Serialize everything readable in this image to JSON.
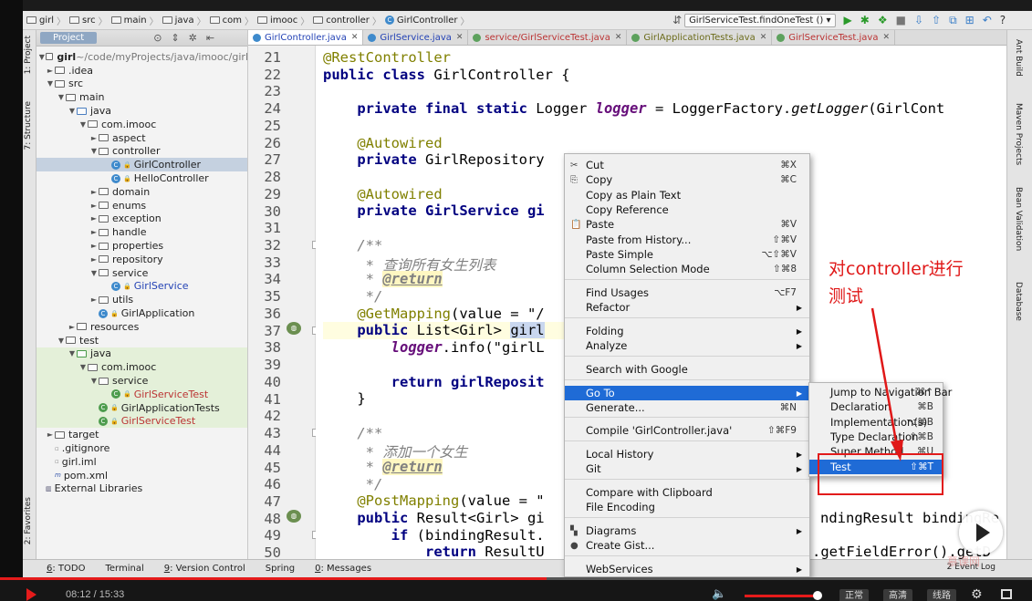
{
  "navbar": {
    "crumbs": [
      "girl",
      "src",
      "main",
      "java",
      "com",
      "imooc",
      "controller",
      "GirlController"
    ],
    "run_config": "GirlServiceTest.findOneTest ()"
  },
  "left_tabs": [
    "1: Project",
    "7: Structure",
    "2: Favorites"
  ],
  "project": {
    "title": "Project",
    "tree": [
      {
        "label": "girl",
        "suffix": " ~/code/myProjects/java/imooc/girl",
        "arrow": "▼",
        "icon": "folder",
        "bold": true
      },
      {
        "label": ".idea",
        "arrow": "►",
        "icon": "folder"
      },
      {
        "label": "src",
        "arrow": "▼",
        "icon": "folder"
      },
      {
        "label": "main",
        "arrow": "▼",
        "icon": "folder"
      },
      {
        "label": "java",
        "arrow": "▼",
        "icon": "srcfolder"
      },
      {
        "label": "com.imooc",
        "arrow": "▼",
        "icon": "pkg"
      },
      {
        "label": "aspect",
        "arrow": "►",
        "icon": "pkg"
      },
      {
        "label": "controller",
        "arrow": "▼",
        "icon": "pkg"
      },
      {
        "label": "GirlController",
        "arrow": "",
        "icon": "class",
        "selected": true
      },
      {
        "label": "HelloController",
        "arrow": "",
        "icon": "class"
      },
      {
        "label": "domain",
        "arrow": "►",
        "icon": "pkg"
      },
      {
        "label": "enums",
        "arrow": "►",
        "icon": "pkg"
      },
      {
        "label": "exception",
        "arrow": "►",
        "icon": "pkg"
      },
      {
        "label": "handle",
        "arrow": "►",
        "icon": "pkg"
      },
      {
        "label": "properties",
        "arrow": "►",
        "icon": "pkg"
      },
      {
        "label": "repository",
        "arrow": "►",
        "icon": "pkg"
      },
      {
        "label": "service",
        "arrow": "▼",
        "icon": "pkg"
      },
      {
        "label": "GirlService",
        "arrow": "",
        "icon": "class",
        "color": "blue"
      },
      {
        "label": "utils",
        "arrow": "►",
        "icon": "pkg"
      },
      {
        "label": "GirlApplication",
        "arrow": "",
        "icon": "class"
      },
      {
        "label": "resources",
        "arrow": "►",
        "icon": "folder"
      },
      {
        "label": "test",
        "arrow": "▼",
        "icon": "folder"
      },
      {
        "label": "java",
        "arrow": "▼",
        "icon": "testfolder",
        "green": true
      },
      {
        "label": "com.imooc",
        "arrow": "▼",
        "icon": "pkg",
        "green": true
      },
      {
        "label": "service",
        "arrow": "▼",
        "icon": "pkg",
        "green": true
      },
      {
        "label": "GirlServiceTest",
        "arrow": "",
        "icon": "testclass",
        "color": "red",
        "green": true
      },
      {
        "label": "GirlApplicationTests",
        "arrow": "",
        "icon": "testclass",
        "green": true
      },
      {
        "label": "GirlServiceTest",
        "arrow": "",
        "icon": "testclass",
        "color": "red",
        "green": true
      },
      {
        "label": "target",
        "arrow": "►",
        "icon": "folder"
      },
      {
        "label": ".gitignore",
        "arrow": "",
        "icon": "file"
      },
      {
        "label": "girl.iml",
        "arrow": "",
        "icon": "file"
      },
      {
        "label": "pom.xml",
        "arrow": "",
        "icon": "maven"
      },
      {
        "label": "External Libraries",
        "arrow": "",
        "icon": "lib"
      }
    ]
  },
  "tabs": [
    {
      "label": "GirlController.java",
      "active": true,
      "color": "blue"
    },
    {
      "label": "GirlService.java",
      "color": "blue"
    },
    {
      "label": "service/GirlServiceTest.java",
      "color": "red"
    },
    {
      "label": "GirlApplicationTests.java",
      "color": "olive"
    },
    {
      "label": "GirlServiceTest.java",
      "color": "red"
    }
  ],
  "line_numbers": [
    "21",
    "22",
    "23",
    "24",
    "25",
    "26",
    "27",
    "28",
    "29",
    "30",
    "31",
    "32",
    "33",
    "34",
    "35",
    "36",
    "37",
    "38",
    "39",
    "40",
    "41",
    "42",
    "43",
    "44",
    "45",
    "46",
    "47",
    "48",
    "49",
    "50"
  ],
  "code": {
    "l21": "@RestController",
    "l22a": "public class",
    "l22b": " GirlController {",
    "l24a": "    private final static",
    "l24b": " Logger ",
    "l24c": "logger",
    "l24d": " = LoggerFactory.",
    "l24e": "getLogger",
    "l24f": "(GirlCont",
    "l26": "    @Autowired",
    "l27a": "    private",
    "l27b": " GirlRepository",
    "l29": "    @Autowired",
    "l30a": "    private",
    "l30b": " GirlService gi",
    "l32": "    /**",
    "l33": "     * 查询所有女生列表",
    "l34a": "     * ",
    "l34b": "@return",
    "l35": "     */",
    "l36a": "    @GetMapping",
    "l36b": "(value = \"/",
    "l37a": "    public",
    "l37b": " List<Girl> ",
    "l37c": "girl",
    "l38a": "        ",
    "l38b": "logger",
    "l38c": ".info(\"girlL",
    "l40a": "        return",
    "l40b": " girlReposit",
    "l41": "    }",
    "l43": "    /**",
    "l44": "     * 添加一个女生",
    "l45a": "     * ",
    "l45b": "@return",
    "l46": "     */",
    "l47a": "    @PostMapping",
    "l47b": "(value = \"",
    "l48a": "    public",
    "l48b": " Result<Girl> gi",
    "l48c": "ndingResult bindingRe",
    "l49a": "        if",
    "l49b": " (bindingResult.",
    "l50a": "            return",
    "l50b": " ResultU",
    "l50c": ".getFieldError().getD"
  },
  "context_menu": {
    "items": [
      {
        "label": "Cut",
        "shortcut": "⌘X",
        "icon": "✂"
      },
      {
        "label": "Copy",
        "shortcut": "⌘C",
        "icon": "⎘"
      },
      {
        "label": "Copy as Plain Text",
        "shortcut": ""
      },
      {
        "label": "Copy Reference",
        "shortcut": ""
      },
      {
        "label": "Paste",
        "shortcut": "⌘V",
        "icon": "📋"
      },
      {
        "label": "Paste from History...",
        "shortcut": "⇧⌘V"
      },
      {
        "label": "Paste Simple",
        "shortcut": "⌥⇧⌘V"
      },
      {
        "label": "Column Selection Mode",
        "shortcut": "⇧⌘8"
      },
      {
        "label": "Find Usages",
        "shortcut": "⌥F7"
      },
      {
        "label": "Refactor",
        "submenu": true
      },
      {
        "label": "Folding",
        "submenu": true
      },
      {
        "label": "Analyze",
        "submenu": true
      },
      {
        "label": "Search with Google",
        "shortcut": ""
      },
      {
        "label": "Go To",
        "submenu": true,
        "active": true
      },
      {
        "label": "Generate...",
        "shortcut": "⌘N"
      },
      {
        "label": "Compile 'GirlController.java'",
        "shortcut": "⇧⌘F9"
      },
      {
        "label": "Local History",
        "submenu": true
      },
      {
        "label": "Git",
        "submenu": true
      },
      {
        "label": "Compare with Clipboard",
        "shortcut": ""
      },
      {
        "label": "File Encoding",
        "shortcut": ""
      },
      {
        "label": "Diagrams",
        "submenu": true,
        "icon": "▚"
      },
      {
        "label": "Create Gist...",
        "shortcut": "",
        "icon": "●"
      },
      {
        "label": "WebServices",
        "submenu": true
      }
    ]
  },
  "submenu": {
    "items": [
      {
        "label": "Jump to Navigation Bar",
        "shortcut": "⌘↑"
      },
      {
        "label": "Declaration",
        "shortcut": "⌘B"
      },
      {
        "label": "Implementation(s)",
        "shortcut": "⌥⌘B"
      },
      {
        "label": "Type Declaration",
        "shortcut": "⇧⌘B"
      },
      {
        "label": "Super Method",
        "shortcut": "⌘U"
      },
      {
        "label": "Test",
        "shortcut": "⇧⌘T",
        "active": true
      }
    ]
  },
  "annotation": {
    "line1": "对controller进行",
    "line2": "测试",
    "color": "#e01818"
  },
  "right_tabs": [
    "Ant Build",
    "Maven Projects",
    "Bean Validation",
    "Database"
  ],
  "bottom_tools": [
    {
      "num": "6",
      "label": ": TODO"
    },
    {
      "num": "",
      "label": "Terminal"
    },
    {
      "num": "9",
      "label": ": Version Control"
    },
    {
      "num": "",
      "label": "Spring"
    },
    {
      "num": "0",
      "label": ": Messages"
    }
  ],
  "event_log": "Event Log",
  "event_log_count": "2",
  "watermark": "慕课网",
  "player": {
    "time": "08:12 / 15:33",
    "progress": 0.53,
    "volume": 0.97,
    "quality_buttons": [
      "正常",
      "高清",
      "线路"
    ],
    "accent": "#e51b1b"
  }
}
